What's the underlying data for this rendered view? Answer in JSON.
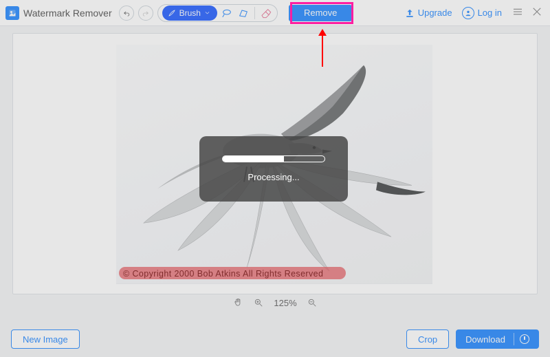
{
  "app": {
    "title": "Watermark Remover"
  },
  "toolbar": {
    "brush_label": "Brush",
    "remove_label": "Remove"
  },
  "header": {
    "upgrade_label": "Upgrade",
    "login_label": "Log in"
  },
  "canvas": {
    "watermark_text": "© Copyright  2000  Bob Atkins  All Rights Reserved"
  },
  "overlay": {
    "status_text": "Processing...",
    "progress_percent": 60
  },
  "zoom": {
    "level": "125%"
  },
  "footer": {
    "new_image_label": "New Image",
    "crop_label": "Crop",
    "download_label": "Download"
  },
  "colors": {
    "accent": "#2a8cff",
    "brush": "#2a63ff",
    "highlight_pink": "#ff1ea1",
    "annotation_red": "#ff0000"
  }
}
